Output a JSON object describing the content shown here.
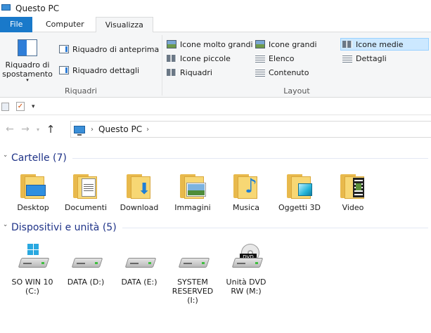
{
  "window": {
    "title": "Questo PC"
  },
  "tabs": [
    {
      "label": "File"
    },
    {
      "label": "Computer"
    },
    {
      "label": "Visualizza"
    }
  ],
  "ribbon": {
    "riquadri": {
      "label": "Riquadri",
      "navigation_pane": "Riquadro di spostamento",
      "preview_pane": "Riquadro di anteprima",
      "details_pane": "Riquadro dettagli"
    },
    "layout": {
      "label": "Layout",
      "options": [
        "Icone molto grandi",
        "Icone grandi",
        "Icone medie",
        "Icone piccole",
        "Elenco",
        "Dettagli",
        "Riquadri",
        "Contenuto"
      ],
      "selected": "Icone medie"
    }
  },
  "address": {
    "crumb": "Questo PC"
  },
  "sections": {
    "folders": {
      "header": "Cartelle (7)",
      "items": [
        "Desktop",
        "Documenti",
        "Download",
        "Immagini",
        "Musica",
        "Oggetti 3D",
        "Video"
      ]
    },
    "devices": {
      "header": "Dispositivi e unità (5)",
      "items": [
        {
          "line1": "SO WIN 10",
          "line2": "(C:)",
          "line3": ""
        },
        {
          "line1": "DATA (D:)",
          "line2": "",
          "line3": ""
        },
        {
          "line1": "DATA (E:)",
          "line2": "",
          "line3": ""
        },
        {
          "line1": "SYSTEM",
          "line2": "RESERVED",
          "line3": "(I:)"
        },
        {
          "line1": "Unità DVD",
          "line2": "RW (M:)",
          "line3": ""
        }
      ],
      "dvd_badge": "DVD"
    }
  },
  "colors": {
    "file_tab": "#1979ca",
    "section_header": "#1e3287",
    "selection": "#cce8ff"
  }
}
